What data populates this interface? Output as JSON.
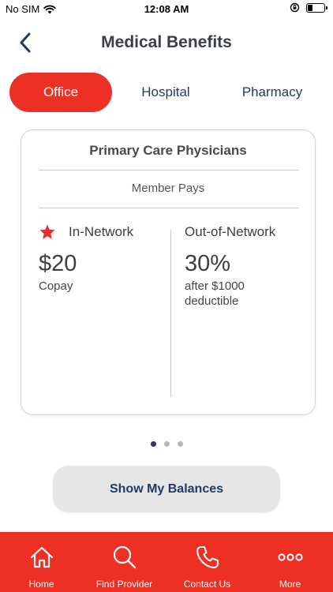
{
  "status_bar": {
    "carrier": "No SIM",
    "time": "12:08 AM"
  },
  "header": {
    "title": "Medical Benefits"
  },
  "tabs": [
    {
      "label": "Office",
      "active": true
    },
    {
      "label": "Hospital",
      "active": false
    },
    {
      "label": "Pharmacy",
      "active": false
    }
  ],
  "card": {
    "title": "Primary Care Physicians",
    "subtitle": "Member Pays",
    "in_network": {
      "label": "In-Network",
      "value": "$20",
      "detail": "Copay"
    },
    "out_of_network": {
      "label": "Out-of-Network",
      "value": "30%",
      "detail_line1": "after $1000",
      "detail_line2": "deductible"
    }
  },
  "pager": {
    "count": 3,
    "active_index": 0
  },
  "balances_button": {
    "label": "Show My Balances"
  },
  "bottom_nav": [
    {
      "label": "Home",
      "icon": "home-icon"
    },
    {
      "label": "Find Provider",
      "icon": "search-icon"
    },
    {
      "label": "Contact Us",
      "icon": "phone-icon"
    },
    {
      "label": "More",
      "icon": "more-icon"
    }
  ],
  "colors": {
    "accent_red": "#ed3024",
    "navy": "#1f3b66"
  }
}
